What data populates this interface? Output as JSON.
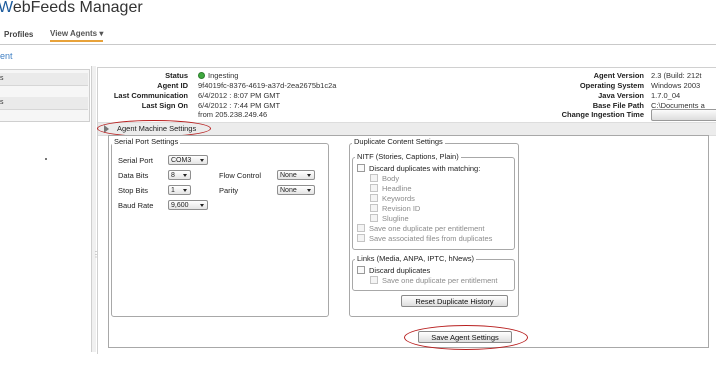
{
  "app": {
    "title_prefix": "W",
    "title_rest": "ebFeeds Manager"
  },
  "nav": {
    "profiles": "Profiles",
    "view_agents": "View Agents ▾"
  },
  "breadcrumb": "ent",
  "sidebar": {
    "items": [
      "s",
      "s"
    ]
  },
  "agent_info": {
    "status_label": "Status",
    "status_value": "Ingesting",
    "id_label": "Agent ID",
    "id_value": "9f4019fc-8376-4619-a37d-2ea2675b1c2a",
    "last_comm_label": "Last Communication",
    "last_comm_value": "6/4/2012 : 8:07 PM GMT",
    "last_sign_label": "Last Sign On",
    "last_sign_value": "6/4/2012 : 7:44 PM GMT",
    "from_value": "from 205.238.249.46",
    "version_label": "Agent Version",
    "version_value": "2.3 (Build: 212t",
    "os_label": "Operating System",
    "os_value": "Windows 2003",
    "java_label": "Java Version",
    "java_value": "1.7.0_04",
    "base_label": "Base File Path",
    "base_value": "C:\\Documents a",
    "ingestion_label": "Change Ingestion Time"
  },
  "machine_settings": {
    "title": "Agent Machine Settings"
  },
  "serial": {
    "legend": "Serial Port Settings",
    "port_label": "Serial Port",
    "port_value": "COM3",
    "data_bits_label": "Data Bits",
    "data_bits_value": "8",
    "flow_label": "Flow Control",
    "flow_value": "None",
    "stop_bits_label": "Stop Bits",
    "stop_bits_value": "1",
    "parity_label": "Parity",
    "parity_value": "None",
    "baud_label": "Baud Rate",
    "baud_value": "9,600"
  },
  "duplicate": {
    "legend": "Duplicate Content Settings",
    "nitf_legend": "NITF (Stories, Captions, Plain)",
    "discard_matching": "Discard duplicates with matching:",
    "body": "Body",
    "headline": "Headline",
    "keywords": "Keywords",
    "revision": "Revision ID",
    "slugline": "Slugline",
    "save_one": "Save one duplicate per entitlement",
    "save_assoc": "Save associated files from duplicates",
    "links_legend": "Links (Media, ANPA, IPTC, hNews)",
    "discard": "Discard duplicates",
    "links_save_one": "Save one duplicate per entitlement",
    "reset": "Reset Duplicate History"
  },
  "save_button": "Save Agent Settings",
  "colors": {
    "accent": "#1b5a9c",
    "link": "#3f7fc4",
    "highlight": "#b82020",
    "status": "#3fa93f"
  }
}
